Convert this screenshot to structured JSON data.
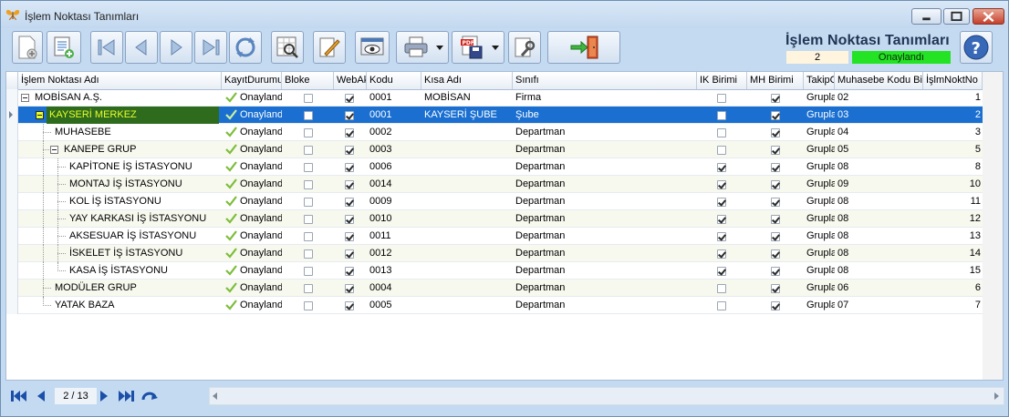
{
  "window": {
    "title": "İşlem Noktası Tanımları"
  },
  "header": {
    "title": "İşlem Noktası Tanımları",
    "record_number": "2",
    "status": "Onaylandı"
  },
  "columns": [
    "İşlem Noktası Adı",
    "KayıtDurumu",
    "Bloke",
    "WebAktif",
    "Kodu",
    "Kısa Adı",
    "Sınıfı",
    "IK Birimi",
    "MH Birimi",
    "TakipGrubu",
    "Muhasebe Kodu Bileşeni",
    "İşlmNoktNo"
  ],
  "rows": [
    {
      "name": "MOBİSAN A.Ş.",
      "status": "Onaylandı",
      "bloke": false,
      "web": true,
      "code": "0001",
      "short": "MOBİSAN",
      "class": "Firma",
      "ik": false,
      "mh": true,
      "takip": "Grupla",
      "muh": "02",
      "no": "1"
    },
    {
      "name": "KAYSERİ MERKEZ",
      "status": "Onaylandı",
      "bloke": false,
      "web": true,
      "code": "0001",
      "short": "KAYSERİ ŞUBE",
      "class": "Şube",
      "ik": false,
      "mh": true,
      "takip": "Grupla",
      "muh": "03",
      "no": "2"
    },
    {
      "name": "MUHASEBE",
      "status": "Onaylandı",
      "bloke": false,
      "web": true,
      "code": "0002",
      "short": "",
      "class": "Departman",
      "ik": false,
      "mh": true,
      "takip": "Grupla",
      "muh": "04",
      "no": "3"
    },
    {
      "name": "KANEPE GRUP",
      "status": "Onaylandı",
      "bloke": false,
      "web": true,
      "code": "0003",
      "short": "",
      "class": "Departman",
      "ik": false,
      "mh": true,
      "takip": "Grupla",
      "muh": "05",
      "no": "5"
    },
    {
      "name": "KAPİTONE İŞ İSTASYONU",
      "status": "Onaylandı",
      "bloke": false,
      "web": true,
      "code": "0006",
      "short": "",
      "class": "Departman",
      "ik": true,
      "mh": true,
      "takip": "Grupla",
      "muh": "08",
      "no": "8"
    },
    {
      "name": "MONTAJ İŞ İSTASYONU",
      "status": "Onaylandı",
      "bloke": false,
      "web": true,
      "code": "0014",
      "short": "",
      "class": "Departman",
      "ik": true,
      "mh": true,
      "takip": "Grupla",
      "muh": "09",
      "no": "10"
    },
    {
      "name": "KOL İŞ İSTASYONU",
      "status": "Onaylandı",
      "bloke": false,
      "web": true,
      "code": "0009",
      "short": "",
      "class": "Departman",
      "ik": true,
      "mh": true,
      "takip": "Grupla",
      "muh": "08",
      "no": "11"
    },
    {
      "name": "YAY KARKASI İŞ İSTASYONU",
      "status": "Onaylandı",
      "bloke": false,
      "web": true,
      "code": "0010",
      "short": "",
      "class": "Departman",
      "ik": true,
      "mh": true,
      "takip": "Grupla",
      "muh": "08",
      "no": "12"
    },
    {
      "name": "AKSESUAR İŞ İSTASYONU",
      "status": "Onaylandı",
      "bloke": false,
      "web": true,
      "code": "0011",
      "short": "",
      "class": "Departman",
      "ik": true,
      "mh": true,
      "takip": "Grupla",
      "muh": "08",
      "no": "13"
    },
    {
      "name": "İSKELET İŞ İSTASYONU",
      "status": "Onaylandı",
      "bloke": false,
      "web": true,
      "code": "0012",
      "short": "",
      "class": "Departman",
      "ik": true,
      "mh": true,
      "takip": "Grupla",
      "muh": "08",
      "no": "14"
    },
    {
      "name": "KASA İŞ İSTASYONU",
      "status": "Onaylandı",
      "bloke": false,
      "web": true,
      "code": "0013",
      "short": "",
      "class": "Departman",
      "ik": true,
      "mh": true,
      "takip": "Grupla",
      "muh": "08",
      "no": "15"
    },
    {
      "name": "MODÜLER GRUP",
      "status": "Onaylandı",
      "bloke": false,
      "web": true,
      "code": "0004",
      "short": "",
      "class": "Departman",
      "ik": false,
      "mh": true,
      "takip": "Grupla",
      "muh": "06",
      "no": "6"
    },
    {
      "name": "YATAK BAZA",
      "status": "Onaylandı",
      "bloke": false,
      "web": true,
      "code": "0005",
      "short": "",
      "class": "Departman",
      "ik": false,
      "mh": true,
      "takip": "Grupla",
      "muh": "07",
      "no": "7"
    }
  ],
  "navigator": {
    "page_info": "2 / 13"
  },
  "colors": {
    "selected_row": "#1a6fd0",
    "status_green": "#24e224",
    "highlight_name": "#2e6b1c",
    "highlight_text": "#e8ff2a"
  }
}
